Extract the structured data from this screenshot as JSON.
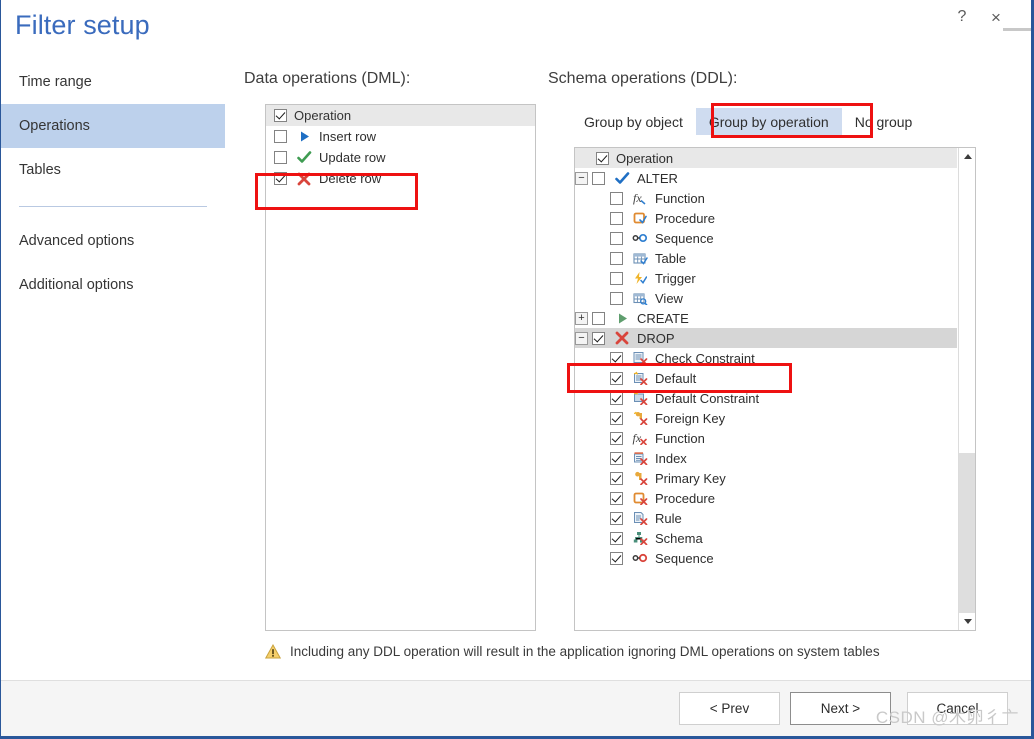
{
  "window": {
    "title": "Filter setup",
    "help_label": "?",
    "close_label": "×"
  },
  "sidebar": {
    "items": [
      {
        "label": "Time range",
        "selected": false
      },
      {
        "label": "Operations",
        "selected": true
      },
      {
        "label": "Tables",
        "selected": false
      },
      {
        "label": "Advanced options",
        "selected": false
      },
      {
        "label": "Additional options",
        "selected": false
      }
    ]
  },
  "dml_panel": {
    "heading": "Data operations (DML):",
    "header_row": {
      "label": "Operation",
      "checked": true
    },
    "rows": [
      {
        "label": "Insert row",
        "checked": false,
        "icon": "insert-row-icon"
      },
      {
        "label": "Update row",
        "checked": false,
        "icon": "update-row-icon"
      },
      {
        "label": "Delete row",
        "checked": true,
        "icon": "delete-row-icon",
        "highlighted": true
      }
    ]
  },
  "ddl_panel": {
    "heading": "Schema operations (DDL):",
    "tabs": [
      {
        "label": "Group by object",
        "active": false
      },
      {
        "label": "Group by operation",
        "active": true,
        "highlighted": true
      },
      {
        "label": "No group",
        "active": false
      }
    ],
    "header_row": {
      "label": "Operation",
      "checked": true
    },
    "tree": [
      {
        "label": "ALTER",
        "checked": false,
        "level": 0,
        "expander": "-",
        "icon": "alter-check-icon"
      },
      {
        "label": "Function",
        "checked": false,
        "level": 1,
        "icon": "function-icon"
      },
      {
        "label": "Procedure",
        "checked": false,
        "level": 1,
        "icon": "procedure-icon"
      },
      {
        "label": "Sequence",
        "checked": false,
        "level": 1,
        "icon": "sequence-icon"
      },
      {
        "label": "Table",
        "checked": false,
        "level": 1,
        "icon": "table-icon"
      },
      {
        "label": "Trigger",
        "checked": false,
        "level": 1,
        "icon": "trigger-icon"
      },
      {
        "label": "View",
        "checked": false,
        "level": 1,
        "icon": "view-icon"
      },
      {
        "label": "CREATE",
        "checked": false,
        "level": 0,
        "expander": "+",
        "icon": "create-play-icon"
      },
      {
        "label": "DROP",
        "checked": true,
        "level": 0,
        "expander": "-",
        "icon": "drop-x-icon",
        "selected": true,
        "highlighted": true
      },
      {
        "label": "Check Constraint",
        "checked": true,
        "level": 1,
        "icon": "check-constraint-drop-icon"
      },
      {
        "label": "Default",
        "checked": true,
        "level": 1,
        "icon": "default-drop-icon"
      },
      {
        "label": "Default Constraint",
        "checked": true,
        "level": 1,
        "icon": "default-constraint-drop-icon"
      },
      {
        "label": "Foreign Key",
        "checked": true,
        "level": 1,
        "icon": "foreign-key-drop-icon"
      },
      {
        "label": "Function",
        "checked": true,
        "level": 1,
        "icon": "function-drop-icon"
      },
      {
        "label": "Index",
        "checked": true,
        "level": 1,
        "icon": "index-drop-icon"
      },
      {
        "label": "Primary Key",
        "checked": true,
        "level": 1,
        "icon": "primary-key-drop-icon"
      },
      {
        "label": "Procedure",
        "checked": true,
        "level": 1,
        "icon": "procedure-drop-icon"
      },
      {
        "label": "Rule",
        "checked": true,
        "level": 1,
        "icon": "rule-drop-icon"
      },
      {
        "label": "Schema",
        "checked": true,
        "level": 1,
        "icon": "schema-drop-icon"
      },
      {
        "label": "Sequence",
        "checked": true,
        "level": 1,
        "icon": "sequence-drop-icon"
      }
    ]
  },
  "warning": {
    "icon": "warning-triangle-icon",
    "text": "Including any DDL operation will result in the application ignoring DML operations on system tables"
  },
  "footer": {
    "prev_label": "< Prev",
    "next_label": "Next >",
    "cancel_label": "Cancel"
  },
  "watermark": {
    "text": "CSDN @木卵彳亠"
  },
  "colors": {
    "title": "#3a6bbd",
    "nav_selected_bg": "#bdd1ec",
    "tab_active_bg": "#cfdcf0",
    "annotation_red": "#ee1111",
    "list_header_bg": "#e8e8e8",
    "tree_selected_bg": "#d6d6d6",
    "window_border": "#2a579a"
  }
}
